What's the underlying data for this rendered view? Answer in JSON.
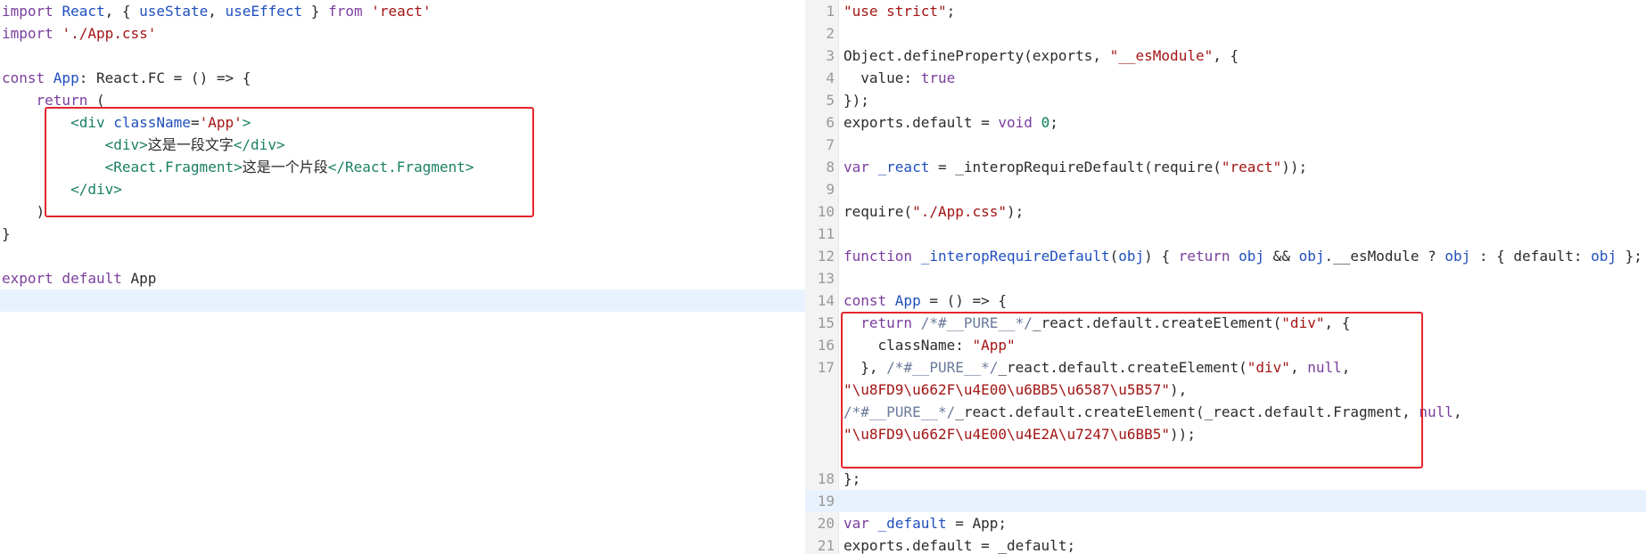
{
  "left_editor": {
    "lines": [
      [
        {
          "t": "import ",
          "c": "kw"
        },
        {
          "t": "React",
          "c": "var"
        },
        {
          "t": ", { ",
          "c": "plain"
        },
        {
          "t": "useState",
          "c": "var"
        },
        {
          "t": ", ",
          "c": "plain"
        },
        {
          "t": "useEffect",
          "c": "var"
        },
        {
          "t": " } ",
          "c": "plain"
        },
        {
          "t": "from ",
          "c": "kw"
        },
        {
          "t": "'react'",
          "c": "str"
        }
      ],
      [
        {
          "t": "import ",
          "c": "kw"
        },
        {
          "t": "'./App.css'",
          "c": "str"
        }
      ],
      [],
      [
        {
          "t": "const ",
          "c": "kw"
        },
        {
          "t": "App",
          "c": "var"
        },
        {
          "t": ": React.FC = () => {",
          "c": "plain"
        }
      ],
      [
        {
          "t": "    ",
          "c": "plain"
        },
        {
          "t": "return",
          "c": "kw"
        },
        {
          "t": " (",
          "c": "plain"
        }
      ],
      [
        {
          "t": "        ",
          "c": "plain"
        },
        {
          "t": "<div ",
          "c": "tag"
        },
        {
          "t": "className",
          "c": "attr"
        },
        {
          "t": "=",
          "c": "plain"
        },
        {
          "t": "'App'",
          "c": "str"
        },
        {
          "t": ">",
          "c": "tag"
        }
      ],
      [
        {
          "t": "            ",
          "c": "plain"
        },
        {
          "t": "<div>",
          "c": "tag"
        },
        {
          "t": "这是一段文字",
          "c": "plain"
        },
        {
          "t": "</div>",
          "c": "tag"
        }
      ],
      [
        {
          "t": "            ",
          "c": "plain"
        },
        {
          "t": "<React.Fragment>",
          "c": "tag"
        },
        {
          "t": "这是一个片段",
          "c": "plain"
        },
        {
          "t": "</React.Fragment>",
          "c": "tag"
        }
      ],
      [
        {
          "t": "        ",
          "c": "plain"
        },
        {
          "t": "</div>",
          "c": "tag"
        }
      ],
      [
        {
          "t": "    )",
          "c": "plain"
        }
      ],
      [
        {
          "t": "}",
          "c": "plain"
        }
      ],
      [],
      [
        {
          "t": "export default ",
          "c": "kw"
        },
        {
          "t": "App",
          "c": "plain"
        }
      ],
      [],
      []
    ],
    "highlighted_line": 13
  },
  "right_editor": {
    "line_numbers": [
      "1",
      "2",
      "3",
      "4",
      "5",
      "6",
      "7",
      "8",
      "9",
      "10",
      "11",
      "12",
      "13",
      "14",
      "15",
      "16",
      "17",
      "",
      "",
      "",
      "",
      "18",
      "19",
      "20",
      "21",
      ""
    ],
    "lines": [
      [
        {
          "t": "\"use strict\"",
          "c": "str"
        },
        {
          "t": ";",
          "c": "plain"
        }
      ],
      [],
      [
        {
          "t": "Object.defineProperty(exports, ",
          "c": "plain"
        },
        {
          "t": "\"__esModule\"",
          "c": "str"
        },
        {
          "t": ", {",
          "c": "plain"
        }
      ],
      [
        {
          "t": "  value: ",
          "c": "plain"
        },
        {
          "t": "true",
          "c": "lit"
        }
      ],
      [
        {
          "t": "});",
          "c": "plain"
        }
      ],
      [
        {
          "t": "exports.default = ",
          "c": "plain"
        },
        {
          "t": "void ",
          "c": "kw"
        },
        {
          "t": "0",
          "c": "num"
        },
        {
          "t": ";",
          "c": "plain"
        }
      ],
      [],
      [
        {
          "t": "var ",
          "c": "kw"
        },
        {
          "t": "_react",
          "c": "var"
        },
        {
          "t": " = _interopRequireDefault(require(",
          "c": "plain"
        },
        {
          "t": "\"react\"",
          "c": "str"
        },
        {
          "t": "));",
          "c": "plain"
        }
      ],
      [],
      [
        {
          "t": "require(",
          "c": "plain"
        },
        {
          "t": "\"./App.css\"",
          "c": "str"
        },
        {
          "t": ");",
          "c": "plain"
        }
      ],
      [],
      [
        {
          "t": "function ",
          "c": "kw"
        },
        {
          "t": "_interopRequireDefault",
          "c": "var"
        },
        {
          "t": "(",
          "c": "plain"
        },
        {
          "t": "obj",
          "c": "var"
        },
        {
          "t": ") { ",
          "c": "plain"
        },
        {
          "t": "return ",
          "c": "kw"
        },
        {
          "t": "obj",
          "c": "var"
        },
        {
          "t": " && ",
          "c": "plain"
        },
        {
          "t": "obj",
          "c": "var"
        },
        {
          "t": ".__esModule ? ",
          "c": "plain"
        },
        {
          "t": "obj",
          "c": "var"
        },
        {
          "t": " : { default: ",
          "c": "plain"
        },
        {
          "t": "obj",
          "c": "var"
        },
        {
          "t": " }; }",
          "c": "plain"
        }
      ],
      [],
      [
        {
          "t": "const ",
          "c": "kw"
        },
        {
          "t": "App",
          "c": "var"
        },
        {
          "t": " = () => {",
          "c": "plain"
        }
      ],
      [
        {
          "t": "  ",
          "c": "plain"
        },
        {
          "t": "return ",
          "c": "kw"
        },
        {
          "t": "/*#__PURE__*/",
          "c": "cm"
        },
        {
          "t": "_react.default.createElement(",
          "c": "plain"
        },
        {
          "t": "\"div\"",
          "c": "str"
        },
        {
          "t": ", {",
          "c": "plain"
        }
      ],
      [
        {
          "t": "    className: ",
          "c": "plain"
        },
        {
          "t": "\"App\"",
          "c": "str"
        }
      ],
      [
        {
          "t": "  }, ",
          "c": "plain"
        },
        {
          "t": "/*#__PURE__*/",
          "c": "cm"
        },
        {
          "t": "_react.default.createElement(",
          "c": "plain"
        },
        {
          "t": "\"div\"",
          "c": "str"
        },
        {
          "t": ", ",
          "c": "plain"
        },
        {
          "t": "null",
          "c": "lit"
        },
        {
          "t": ",",
          "c": "plain"
        }
      ],
      [
        {
          "t": "\"\\u8FD9\\u662F\\u4E00\\u6BB5\\u6587\\u5B57\"",
          "c": "str"
        },
        {
          "t": "),",
          "c": "plain"
        }
      ],
      [
        {
          "t": "/*#__PURE__*/",
          "c": "cm"
        },
        {
          "t": "_react.default.createElement(_react.default.Fragment, ",
          "c": "plain"
        },
        {
          "t": "null",
          "c": "lit"
        },
        {
          "t": ",",
          "c": "plain"
        }
      ],
      [
        {
          "t": "\"\\u8FD9\\u662F\\u4E00\\u4E2A\\u7247\\u6BB5\"",
          "c": "str"
        },
        {
          "t": "));",
          "c": "plain"
        }
      ],
      [],
      [
        {
          "t": "};",
          "c": "plain"
        }
      ],
      [],
      [
        {
          "t": "var ",
          "c": "kw"
        },
        {
          "t": "_default",
          "c": "var"
        },
        {
          "t": " = App;",
          "c": "plain"
        }
      ],
      [
        {
          "t": "exports.default = _default;",
          "c": "plain"
        }
      ],
      []
    ],
    "highlighted_line": 22
  }
}
